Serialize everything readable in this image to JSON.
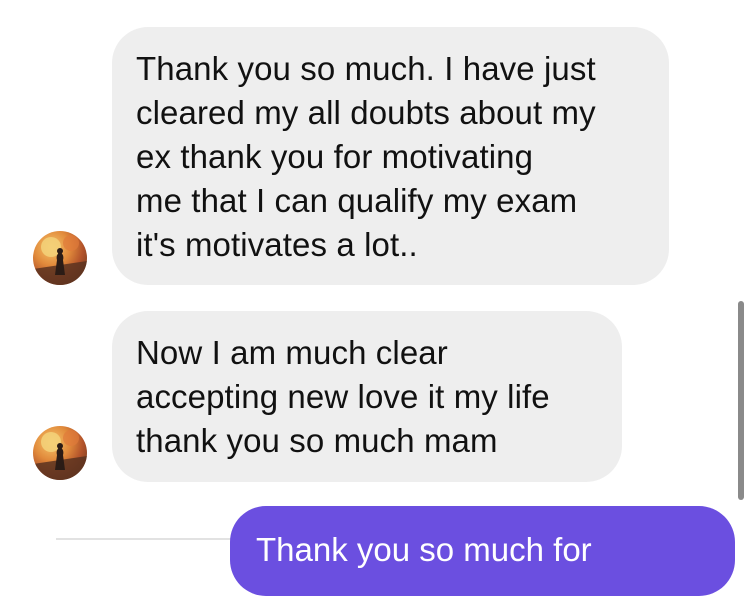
{
  "messages": [
    {
      "direction": "incoming",
      "text": "Thank you so much. I have just\ncleared my all doubts about my\nex  thank you for motivating\nme that I can qualify my exam\nit's motivates a lot.."
    },
    {
      "direction": "incoming",
      "text": "Now I am much clear\naccepting new love it my life\nthank you so much mam"
    },
    {
      "direction": "outgoing",
      "text": "Thank you so much for"
    }
  ],
  "colors": {
    "incoming_bubble": "#eeeeee",
    "outgoing_bubble": "#6b4fe0",
    "background": "#ffffff"
  },
  "icons": {
    "avatar": "profile-avatar-icon"
  }
}
